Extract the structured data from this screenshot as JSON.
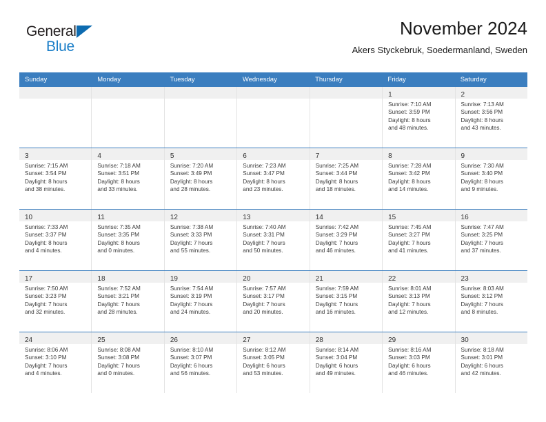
{
  "brand": {
    "name_top": "General",
    "name_bottom": "Blue",
    "triangle_icon": "triangle-icon",
    "color_dark": "#231f20",
    "color_blue": "#1a7ec8",
    "color_triangle": "#0d6bb0"
  },
  "header": {
    "title": "November 2024",
    "subtitle": "Akers Styckebruk, Soedermanland, Sweden"
  },
  "theme": {
    "header_blue": "#3b7ebf",
    "band_gray": "#f0f0f0",
    "cell_border": "#e3e3e3"
  },
  "day_headers": [
    "Sunday",
    "Monday",
    "Tuesday",
    "Wednesday",
    "Thursday",
    "Friday",
    "Saturday"
  ],
  "weeks": [
    [
      {
        "day": "",
        "lines": []
      },
      {
        "day": "",
        "lines": []
      },
      {
        "day": "",
        "lines": []
      },
      {
        "day": "",
        "lines": []
      },
      {
        "day": "",
        "lines": []
      },
      {
        "day": "1",
        "lines": [
          "Sunrise: 7:10 AM",
          "Sunset: 3:59 PM",
          "Daylight: 8 hours",
          "and 48 minutes."
        ]
      },
      {
        "day": "2",
        "lines": [
          "Sunrise: 7:13 AM",
          "Sunset: 3:56 PM",
          "Daylight: 8 hours",
          "and 43 minutes."
        ]
      }
    ],
    [
      {
        "day": "3",
        "lines": [
          "Sunrise: 7:15 AM",
          "Sunset: 3:54 PM",
          "Daylight: 8 hours",
          "and 38 minutes."
        ]
      },
      {
        "day": "4",
        "lines": [
          "Sunrise: 7:18 AM",
          "Sunset: 3:51 PM",
          "Daylight: 8 hours",
          "and 33 minutes."
        ]
      },
      {
        "day": "5",
        "lines": [
          "Sunrise: 7:20 AM",
          "Sunset: 3:49 PM",
          "Daylight: 8 hours",
          "and 28 minutes."
        ]
      },
      {
        "day": "6",
        "lines": [
          "Sunrise: 7:23 AM",
          "Sunset: 3:47 PM",
          "Daylight: 8 hours",
          "and 23 minutes."
        ]
      },
      {
        "day": "7",
        "lines": [
          "Sunrise: 7:25 AM",
          "Sunset: 3:44 PM",
          "Daylight: 8 hours",
          "and 18 minutes."
        ]
      },
      {
        "day": "8",
        "lines": [
          "Sunrise: 7:28 AM",
          "Sunset: 3:42 PM",
          "Daylight: 8 hours",
          "and 14 minutes."
        ]
      },
      {
        "day": "9",
        "lines": [
          "Sunrise: 7:30 AM",
          "Sunset: 3:40 PM",
          "Daylight: 8 hours",
          "and 9 minutes."
        ]
      }
    ],
    [
      {
        "day": "10",
        "lines": [
          "Sunrise: 7:33 AM",
          "Sunset: 3:37 PM",
          "Daylight: 8 hours",
          "and 4 minutes."
        ]
      },
      {
        "day": "11",
        "lines": [
          "Sunrise: 7:35 AM",
          "Sunset: 3:35 PM",
          "Daylight: 8 hours",
          "and 0 minutes."
        ]
      },
      {
        "day": "12",
        "lines": [
          "Sunrise: 7:38 AM",
          "Sunset: 3:33 PM",
          "Daylight: 7 hours",
          "and 55 minutes."
        ]
      },
      {
        "day": "13",
        "lines": [
          "Sunrise: 7:40 AM",
          "Sunset: 3:31 PM",
          "Daylight: 7 hours",
          "and 50 minutes."
        ]
      },
      {
        "day": "14",
        "lines": [
          "Sunrise: 7:42 AM",
          "Sunset: 3:29 PM",
          "Daylight: 7 hours",
          "and 46 minutes."
        ]
      },
      {
        "day": "15",
        "lines": [
          "Sunrise: 7:45 AM",
          "Sunset: 3:27 PM",
          "Daylight: 7 hours",
          "and 41 minutes."
        ]
      },
      {
        "day": "16",
        "lines": [
          "Sunrise: 7:47 AM",
          "Sunset: 3:25 PM",
          "Daylight: 7 hours",
          "and 37 minutes."
        ]
      }
    ],
    [
      {
        "day": "17",
        "lines": [
          "Sunrise: 7:50 AM",
          "Sunset: 3:23 PM",
          "Daylight: 7 hours",
          "and 32 minutes."
        ]
      },
      {
        "day": "18",
        "lines": [
          "Sunrise: 7:52 AM",
          "Sunset: 3:21 PM",
          "Daylight: 7 hours",
          "and 28 minutes."
        ]
      },
      {
        "day": "19",
        "lines": [
          "Sunrise: 7:54 AM",
          "Sunset: 3:19 PM",
          "Daylight: 7 hours",
          "and 24 minutes."
        ]
      },
      {
        "day": "20",
        "lines": [
          "Sunrise: 7:57 AM",
          "Sunset: 3:17 PM",
          "Daylight: 7 hours",
          "and 20 minutes."
        ]
      },
      {
        "day": "21",
        "lines": [
          "Sunrise: 7:59 AM",
          "Sunset: 3:15 PM",
          "Daylight: 7 hours",
          "and 16 minutes."
        ]
      },
      {
        "day": "22",
        "lines": [
          "Sunrise: 8:01 AM",
          "Sunset: 3:13 PM",
          "Daylight: 7 hours",
          "and 12 minutes."
        ]
      },
      {
        "day": "23",
        "lines": [
          "Sunrise: 8:03 AM",
          "Sunset: 3:12 PM",
          "Daylight: 7 hours",
          "and 8 minutes."
        ]
      }
    ],
    [
      {
        "day": "24",
        "lines": [
          "Sunrise: 8:06 AM",
          "Sunset: 3:10 PM",
          "Daylight: 7 hours",
          "and 4 minutes."
        ]
      },
      {
        "day": "25",
        "lines": [
          "Sunrise: 8:08 AM",
          "Sunset: 3:08 PM",
          "Daylight: 7 hours",
          "and 0 minutes."
        ]
      },
      {
        "day": "26",
        "lines": [
          "Sunrise: 8:10 AM",
          "Sunset: 3:07 PM",
          "Daylight: 6 hours",
          "and 56 minutes."
        ]
      },
      {
        "day": "27",
        "lines": [
          "Sunrise: 8:12 AM",
          "Sunset: 3:05 PM",
          "Daylight: 6 hours",
          "and 53 minutes."
        ]
      },
      {
        "day": "28",
        "lines": [
          "Sunrise: 8:14 AM",
          "Sunset: 3:04 PM",
          "Daylight: 6 hours",
          "and 49 minutes."
        ]
      },
      {
        "day": "29",
        "lines": [
          "Sunrise: 8:16 AM",
          "Sunset: 3:03 PM",
          "Daylight: 6 hours",
          "and 46 minutes."
        ]
      },
      {
        "day": "30",
        "lines": [
          "Sunrise: 8:18 AM",
          "Sunset: 3:01 PM",
          "Daylight: 6 hours",
          "and 42 minutes."
        ]
      }
    ]
  ]
}
